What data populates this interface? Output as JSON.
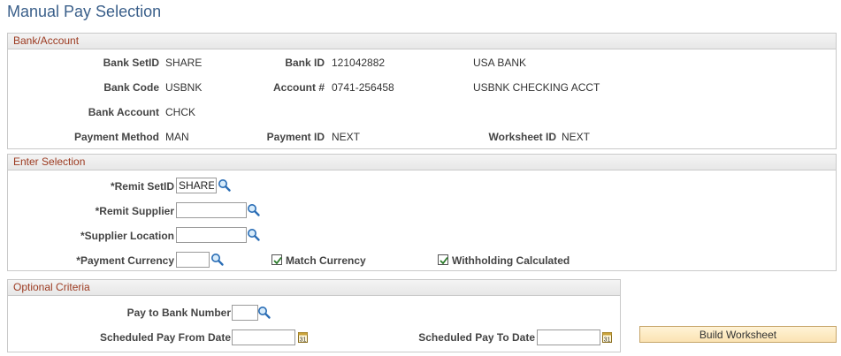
{
  "page": {
    "title": "Manual Pay Selection"
  },
  "bank_account": {
    "header": "Bank/Account",
    "bank_setid_label": "Bank SetID",
    "bank_setid": "SHARE",
    "bank_id_label": "Bank ID",
    "bank_id": "121042882",
    "bank_name": "USA BANK",
    "bank_code_label": "Bank Code",
    "bank_code": "USBNK",
    "account_label": "Account #",
    "account": "0741-256458",
    "account_name": "USBNK CHECKING ACCT",
    "bank_account_label": "Bank Account",
    "bank_account": "CHCK",
    "payment_method_label": "Payment Method",
    "payment_method": "MAN",
    "payment_id_label": "Payment ID",
    "payment_id": "NEXT",
    "worksheet_id_label": "Worksheet ID",
    "worksheet_id": "NEXT"
  },
  "enter_selection": {
    "header": "Enter Selection",
    "remit_setid_label": "*Remit SetID",
    "remit_setid_value": "SHARE",
    "remit_supplier_label": "*Remit Supplier",
    "remit_supplier_value": "",
    "supplier_location_label": "*Supplier Location",
    "supplier_location_value": "",
    "payment_currency_label": "*Payment Currency",
    "payment_currency_value": "",
    "match_currency_label": "Match Currency",
    "match_currency_checked": true,
    "withholding_label": "Withholding Calculated",
    "withholding_checked": true
  },
  "optional_criteria": {
    "header": "Optional Criteria",
    "pay_to_bank_label": "Pay to Bank Number",
    "pay_to_bank_value": "",
    "from_date_label": "Scheduled Pay From Date",
    "from_date_value": "",
    "to_date_label": "Scheduled Pay To Date",
    "to_date_value": ""
  },
  "actions": {
    "build_worksheet_label": "Build Worksheet"
  },
  "icons": {
    "lookup": "magnifier-icon",
    "calendar": "calendar-icon",
    "check": "checkmark-icon"
  },
  "colors": {
    "title": "#3a5f8a",
    "group_header_text": "#9c3a20",
    "button_bg": "#fbe3b3"
  }
}
